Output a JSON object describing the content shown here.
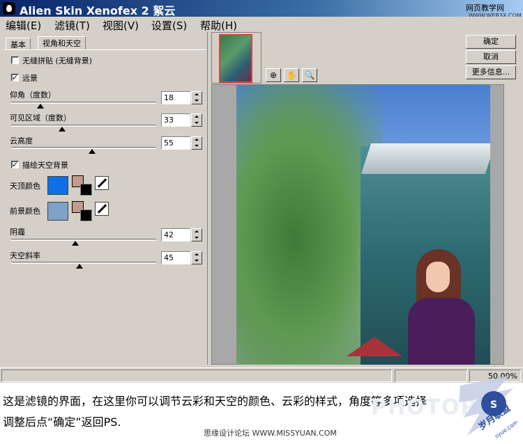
{
  "window": {
    "title": "Alien Skin Xenofex 2 絮云",
    "watermark": "网页教学网",
    "watermark_url": "WWW.WEB3X.COM"
  },
  "menu": [
    "编辑(E)",
    "滤镜(T)",
    "视图(V)",
    "设置(S)",
    "帮助(H)"
  ],
  "tabs": [
    "基本",
    "视角和天空"
  ],
  "options": {
    "seamless_label": "无缝拼贴 (无缝背景)",
    "seamless_checked": false,
    "distance_label": "远景",
    "distance_checked": true,
    "draw_sky_label": "描绘天空背景",
    "draw_sky_checked": true
  },
  "sliders": {
    "elevation": {
      "label": "仰角（度数）",
      "value": "18",
      "level": 0.2
    },
    "visible_area": {
      "label": "可见区域（度数）",
      "value": "33",
      "level": 0.35
    },
    "cloud_height": {
      "label": "云高度",
      "value": "55",
      "level": 0.56
    },
    "shadow": {
      "label": "阴霾",
      "value": "42",
      "level": 0.44
    },
    "sky_slope": {
      "label": "天空斜率",
      "value": "45",
      "level": 0.47
    }
  },
  "colors": {
    "zenith_label": "天顶颜色",
    "zenith_color": "#0f6fe8",
    "foreground_label": "前景颜色",
    "foreground_color": "#7ea2c6"
  },
  "buttons": {
    "ok": "确定",
    "cancel": "取消",
    "more_info": "更多信息..."
  },
  "tools": [
    "preview-toggle-icon",
    "hand-icon",
    "zoom-icon"
  ],
  "status": {
    "zoom": "50.00%"
  },
  "caption": {
    "line1": "这是滤镜的界面，在这里你可以调节云彩和天空的颜色、云彩的样式，角度等多项选择",
    "line2": "调整后点“确定”返回PS."
  },
  "footer": "思缘设计论坛 WWW.MISSYUAN.COM",
  "overlay": {
    "stamp": "PHOTOPS",
    "seal_text": "岁月联盟",
    "seal_url": "syue.com"
  }
}
